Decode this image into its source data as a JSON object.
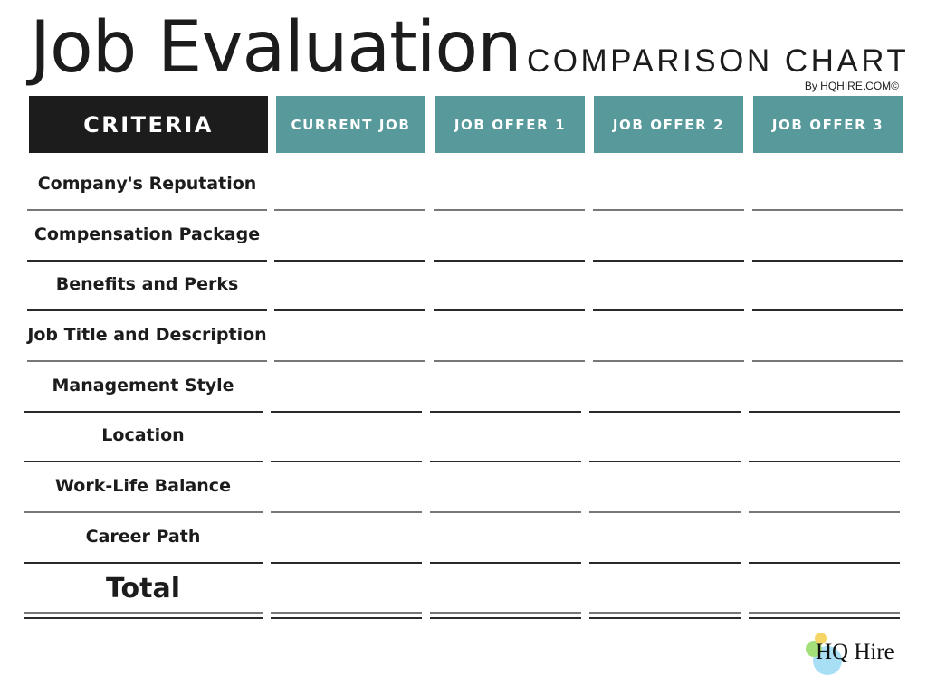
{
  "header": {
    "title": "Job Evaluation",
    "subtitle": "COMPARISON CHART",
    "byline": "By HQHIRE.COM©"
  },
  "columns": {
    "criteria": "CRITERIA",
    "jobs": [
      "CURRENT JOB",
      "JOB OFFER 1",
      "JOB OFFER 2",
      "JOB OFFER 3"
    ]
  },
  "rows": [
    {
      "label": "Company's Reputation",
      "values": [
        "",
        "",
        "",
        ""
      ]
    },
    {
      "label": "Compensation Package",
      "values": [
        "",
        "",
        "",
        ""
      ]
    },
    {
      "label": "Benefits and Perks",
      "values": [
        "",
        "",
        "",
        ""
      ]
    },
    {
      "label": "Job Title and Description",
      "values": [
        "",
        "",
        "",
        ""
      ]
    },
    {
      "label": "Management Style",
      "values": [
        "",
        "",
        "",
        ""
      ]
    },
    {
      "label": "Location",
      "values": [
        "",
        "",
        "",
        ""
      ]
    },
    {
      "label": "Work-Life Balance",
      "values": [
        "",
        "",
        "",
        ""
      ]
    },
    {
      "label": "Career Path",
      "values": [
        "",
        "",
        "",
        ""
      ]
    }
  ],
  "total": {
    "label": "Total",
    "values": [
      "",
      "",
      "",
      ""
    ]
  },
  "logo": {
    "text": "HQ Hire",
    "icon": "colored-circles-logo"
  },
  "colors": {
    "header_dark": "#1c1c1c",
    "header_accent": "#58999c",
    "logo_yellow": "#f5d565",
    "logo_green": "#a3e07a",
    "logo_blue": "#a9dff5"
  }
}
